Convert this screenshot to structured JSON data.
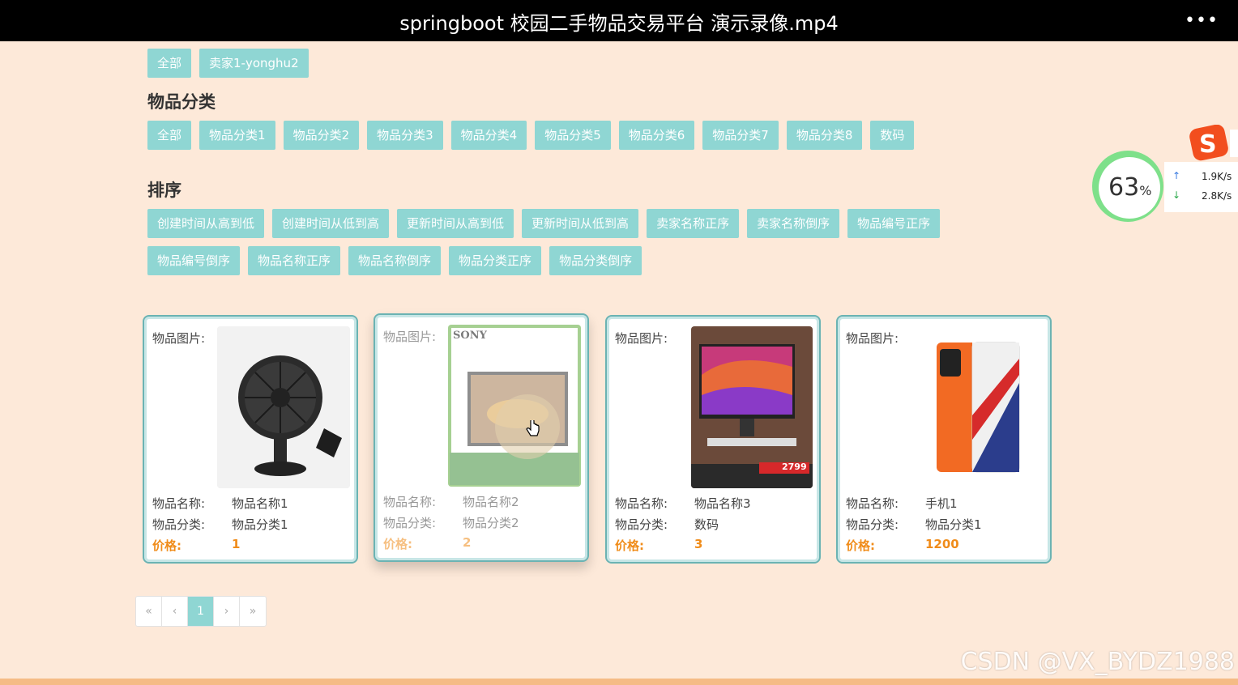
{
  "video": {
    "title": "springboot 校园二手物品交易平台 演示录像.mp4",
    "more_label": "•••"
  },
  "seller_filter": {
    "items": [
      "全部",
      "卖家1-yonghu2"
    ]
  },
  "category": {
    "heading": "物品分类",
    "items": [
      "全部",
      "物品分类1",
      "物品分类2",
      "物品分类3",
      "物品分类4",
      "物品分类5",
      "物品分类6",
      "物品分类7",
      "物品分类8",
      "数码"
    ]
  },
  "sort": {
    "heading": "排序",
    "row1": [
      "创建时间从高到低",
      "创建时间从低到高",
      "更新时间从高到低",
      "更新时间从低到高",
      "卖家名称正序",
      "卖家名称倒序",
      "物品编号正序"
    ],
    "row2": [
      "物品编号倒序",
      "物品名称正序",
      "物品名称倒序",
      "物品分类正序",
      "物品分类倒序"
    ]
  },
  "labels": {
    "image": "物品图片:",
    "name": "物品名称:",
    "category": "物品分类:",
    "price": "价格:"
  },
  "products": [
    {
      "name": "物品名称1",
      "category": "物品分类1",
      "price": "1",
      "image": "desk-fan-image"
    },
    {
      "name": "物品名称2",
      "category": "物品分类2",
      "price": "2",
      "image": "sony-tv-image",
      "image_text": "SONY"
    },
    {
      "name": "物品名称3",
      "category": "数码",
      "price": "3",
      "image": "computer-monitor-image",
      "image_price": "2799"
    },
    {
      "name": "手机1",
      "category": "物品分类1",
      "price": "1200",
      "image": "iqoo-phone-image"
    }
  ],
  "pagination": {
    "first": "«",
    "prev": "‹",
    "current": "1",
    "next": "›",
    "last": "»"
  },
  "net_monitor": {
    "percent": "63",
    "percent_sign": "%",
    "up": "1.9K/s",
    "down": "2.8K/s"
  },
  "watermark": "CSDN @VX_BYDZ1988",
  "colors": {
    "accent": "#8fd6d3",
    "price": "#f08c1a",
    "background": "#fde9d9",
    "card_border": "#6bb3b3"
  }
}
